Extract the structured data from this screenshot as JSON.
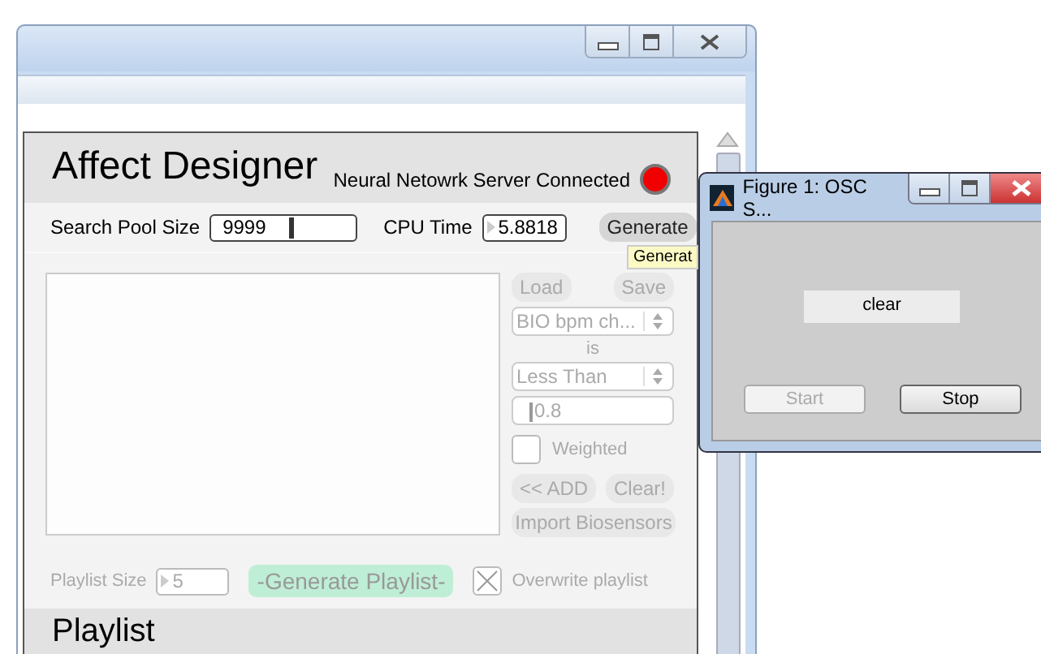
{
  "main_window": {
    "title_bar": {
      "buttons": [
        {
          "kind": "minimize"
        },
        {
          "kind": "maximize"
        },
        {
          "kind": "close"
        }
      ]
    }
  },
  "affect_designer": {
    "title": "Affect Designer",
    "server_status": {
      "label": "Neural Netowrk Server Connected",
      "on": false
    },
    "search_pool_size": {
      "label": "Search Pool Size",
      "value": "9999"
    },
    "cpu_time": {
      "label": "CPU Time",
      "value": "5.8818"
    },
    "generate_button": {
      "label": "Generate",
      "disabled": false
    },
    "tooltip": "Generat",
    "load_button": {
      "label": "Load",
      "disabled": true
    },
    "save_button": {
      "label": "Save",
      "disabled": true
    },
    "sensor_select": {
      "value": "BIO bpm ch...",
      "disabled": true
    },
    "is_label": "is",
    "comparison_select": {
      "value": "Less Than",
      "disabled": true
    },
    "threshold_field": {
      "value": "0.8",
      "disabled": true
    },
    "weighted": {
      "label": "Weighted",
      "checked": false,
      "disabled": true
    },
    "add_button": {
      "label": "<< ADD",
      "disabled": true
    },
    "clear_button": {
      "label": "Clear!",
      "disabled": true
    },
    "import_button": {
      "label": "Import Biosensors",
      "disabled": true
    },
    "playlist_size": {
      "label": "Playlist Size",
      "value": "5",
      "disabled": true
    },
    "generate_playlist_button": {
      "label": "-Generate Playlist-",
      "disabled": true
    },
    "overwrite": {
      "label": "Overwrite playlist",
      "checked": true,
      "disabled": true
    },
    "playlist_heading": "Playlist"
  },
  "figure_window": {
    "title": "Figure 1: OSC S...",
    "status_label": "clear",
    "buttons": [
      {
        "label": "Start",
        "disabled": true
      },
      {
        "label": "Stop",
        "disabled": false
      }
    ]
  }
}
